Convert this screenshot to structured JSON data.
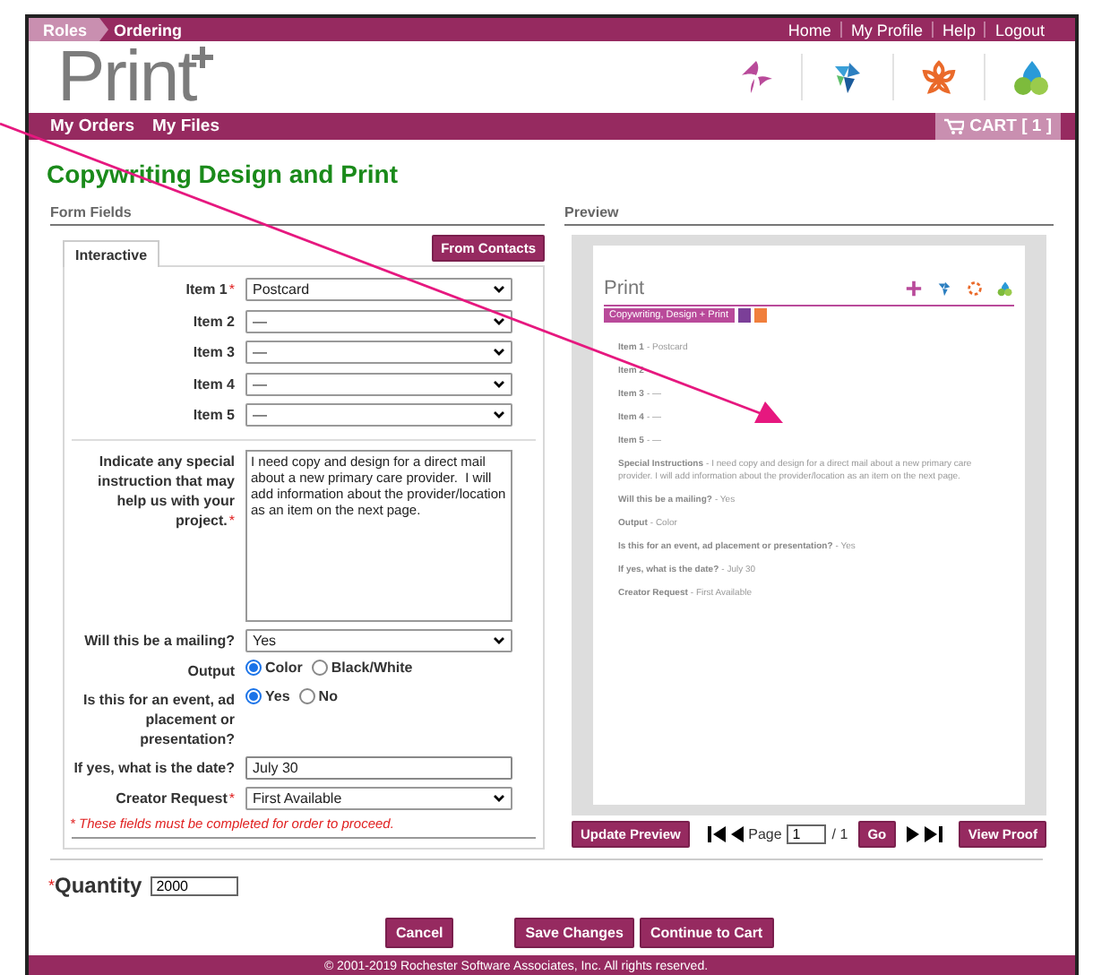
{
  "top_bar": {
    "breadcrumbs": [
      {
        "label": "Roles",
        "selected": false
      },
      {
        "label": "Ordering",
        "selected": true
      }
    ],
    "links": [
      "Home",
      "My Profile",
      "Help",
      "Logout"
    ]
  },
  "logo": {
    "text": "Print"
  },
  "nav": {
    "items": [
      "My Orders",
      "My Files"
    ],
    "cart": "CART [ 1 ]"
  },
  "page_title": "Copywriting Design and Print",
  "form": {
    "heading": "Form Fields",
    "tabs": [
      {
        "label": "Interactive",
        "selected": true
      }
    ],
    "contacts_button": "From Contacts",
    "items": [
      {
        "label": "Item 1",
        "required_mark": "*",
        "value": "Postcard"
      },
      {
        "label": "Item 2",
        "value": "—"
      },
      {
        "label": "Item 3",
        "value": "—"
      },
      {
        "label": "Item 4",
        "value": "—"
      },
      {
        "label": "Item 5",
        "value": "—"
      }
    ],
    "instructions": {
      "label": "Indicate any special instruction that may help us with your project.",
      "required_mark": "*",
      "value": "I need copy and design for a direct mail about a new primary care provider.  I will add information about the provider/location as an item on the next page."
    },
    "questions": [
      {
        "kind": "select",
        "label": "Will this be a mailing?",
        "value": "Yes"
      },
      {
        "kind": "radio",
        "label": "Output",
        "options": [
          {
            "label": "Color",
            "selected": true
          },
          {
            "label": "Black/White",
            "selected": false
          }
        ]
      },
      {
        "kind": "radio",
        "label": "Is this for an event, ad placement or presentation?",
        "options": [
          {
            "label": "Yes",
            "selected": true
          },
          {
            "label": "No",
            "selected": false
          }
        ]
      },
      {
        "kind": "text",
        "label": "If yes, what is the date?",
        "value": "July 30"
      },
      {
        "kind": "select",
        "label": "Creator Request",
        "required_mark": "*",
        "value": "First Available"
      }
    ],
    "note": "* These fields must be completed for order to proceed."
  },
  "quantity": {
    "label": "Quantity",
    "required_mark": "*",
    "value": "2000"
  },
  "preview": {
    "heading": "Preview",
    "doc": {
      "logo": "Print",
      "banner": "Copywriting, Design + Print",
      "lines": [
        {
          "label": "Item 1",
          "value": "- Postcard"
        },
        {
          "label": "Item 2"
        },
        {
          "label": "Item 3",
          "value": "- —"
        },
        {
          "label": "Item 4",
          "value": "- —"
        },
        {
          "label": "Item 5",
          "value": "- —"
        },
        {
          "label": "Special Instructions",
          "value": "- I need copy and design for a direct mail about a new primary care provider. I will add information about the provider/location as an item on the next page."
        },
        {
          "label": "Will this be a mailing?",
          "value": "- Yes"
        },
        {
          "label": "Output",
          "value": "- Color"
        },
        {
          "label": "Is this for an event, ad placement or presentation?",
          "value": "- Yes"
        },
        {
          "label": "If yes, what is the date?",
          "value": "- July 30"
        },
        {
          "label": "Creator Request",
          "value": "- First Available"
        }
      ]
    },
    "update_button": "Update Preview",
    "page_label": "Page",
    "page_value": "1",
    "page_total": "/ 1",
    "go_button": "Go",
    "view_proof_button": "View Proof"
  },
  "buttons": [
    "Cancel",
    "Save Changes",
    "Continue to Cart"
  ],
  "footer": "© 2001-2019 Rochester Software Associates, Inc. All rights reserved."
}
